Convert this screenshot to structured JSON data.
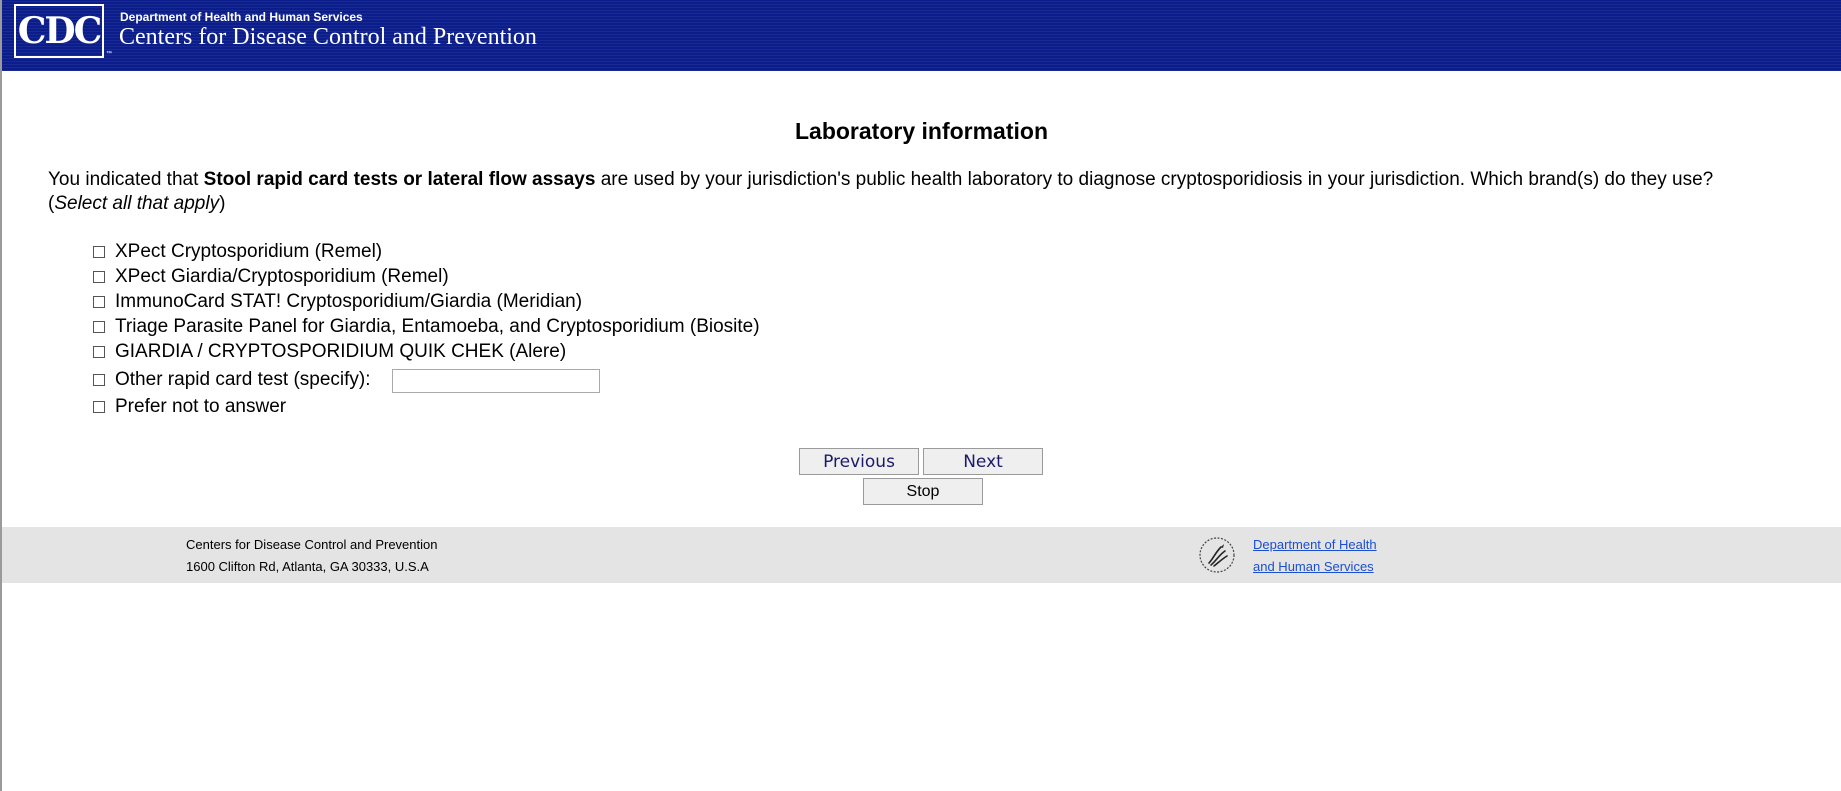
{
  "header": {
    "logo_text": "CDC",
    "trademark": "™",
    "department": "Department of Health and Human Services",
    "agency_name": "Centers for Disease Control and Prevention",
    "background_color": "#0b1d8a"
  },
  "main": {
    "title": "Laboratory information",
    "question": {
      "prefix": "You indicated that ",
      "bold": "Stool rapid card tests or lateral flow assays",
      "suffix": " are used by your jurisdiction's public health laboratory to diagnose cryptosporidiosis in your jurisdiction. Which brand(s) do they use?",
      "open_paren": "(",
      "instruction": "Select all that apply",
      "close_paren": ")"
    },
    "options": [
      {
        "label": "XPect Cryptosporidium (Remel)",
        "checked": false
      },
      {
        "label": "XPect Giardia/Cryptosporidium (Remel)",
        "checked": false
      },
      {
        "label": "ImmunoCard STAT! Cryptosporidium/Giardia (Meridian)",
        "checked": false
      },
      {
        "label": "Triage Parasite Panel for Giardia, Entamoeba, and Cryptosporidium (Biosite)",
        "checked": false
      },
      {
        "label": "GIARDIA / CRYPTOSPORIDIUM QUIK CHEK (Alere)",
        "checked": false
      },
      {
        "label": "Other rapid card test (specify):",
        "checked": false,
        "input_value": ""
      },
      {
        "label": "Prefer not to answer",
        "checked": false
      }
    ],
    "buttons": {
      "previous": "Previous",
      "next": "Next",
      "stop": "Stop"
    }
  },
  "footer": {
    "org_name": "Centers for Disease Control and Prevention",
    "address": "1600 Clifton Rd, Atlanta, GA 30333, U.S.A",
    "hhs_link_line1": "Department of Health",
    "hhs_link_line2": "and Human Services",
    "hhs_icon": "hhs-eagle-icon",
    "link_color": "#1a4fd0",
    "background_color": "#e4e4e4"
  }
}
